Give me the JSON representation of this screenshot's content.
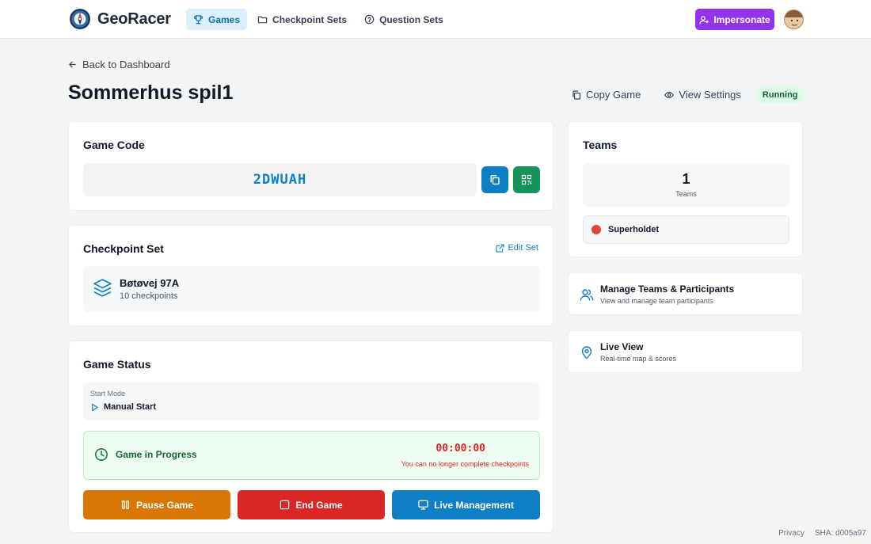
{
  "app": {
    "name": "GeoRacer"
  },
  "nav": {
    "items": [
      {
        "label": "Games",
        "icon": "trophy-icon",
        "active": true
      },
      {
        "label": "Checkpoint Sets",
        "icon": "folder-icon",
        "active": false
      },
      {
        "label": "Question Sets",
        "icon": "question-circle-icon",
        "active": false
      }
    ],
    "impersonate_label": "Impersonate"
  },
  "page": {
    "back_label": "Back to Dashboard",
    "title": "Sommerhus spil1",
    "copy_label": "Copy Game",
    "view_settings_label": "View Settings",
    "status_badge": "Running"
  },
  "game_code": {
    "title": "Game Code",
    "code": "2DWUAH"
  },
  "checkpoint_set": {
    "title": "Checkpoint Set",
    "edit_label": "Edit Set",
    "name": "Bøtøvej 97A",
    "count_text": "10 checkpoints"
  },
  "game_status": {
    "title": "Game Status",
    "start_mode_label": "Start Mode",
    "start_mode_value": "Manual Start",
    "progress_label": "Game in Progress",
    "timer": "00:00:00",
    "timer_note": "You can no longer complete checkpoints",
    "pause_label": "Pause Game",
    "end_label": "End Game",
    "live_mgmt_label": "Live Management"
  },
  "teams": {
    "title": "Teams",
    "count": "1",
    "count_label": "Teams",
    "list": [
      {
        "name": "Superholdet",
        "color": "#e0453a"
      }
    ]
  },
  "links": {
    "manage": {
      "title": "Manage Teams & Participants",
      "subtitle": "View and manage team participants"
    },
    "live": {
      "title": "Live View",
      "subtitle": "Real-time map & scores"
    }
  },
  "footer": {
    "privacy": "Privacy",
    "sha": "SHA: d005a97"
  },
  "colors": {
    "primary": "#0e7fc4",
    "accent_purple": "#9333ea",
    "pause": "#d97706",
    "end": "#dc2626",
    "live": "#0e7fc4",
    "qr": "#15935b"
  }
}
